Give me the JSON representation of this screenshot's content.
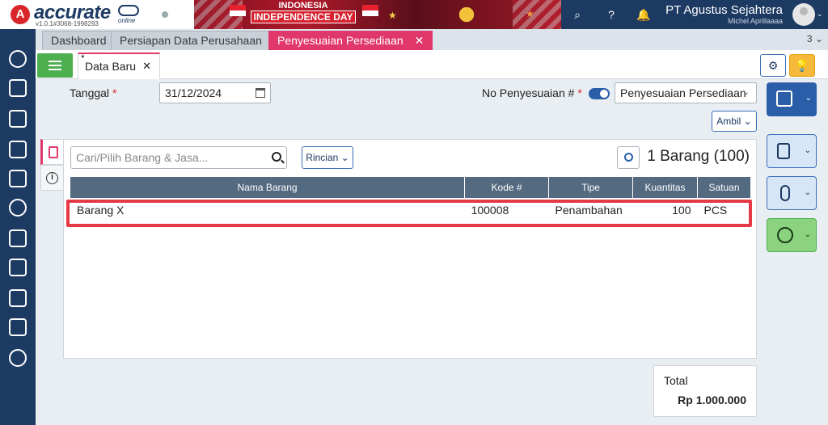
{
  "header": {
    "logo_text": "accurate",
    "logo_sub": "online",
    "version": "v1.0.1#3068-1998293",
    "banner_line1": "INDONESIA",
    "banner_line2": "INDEPENDENCE DAY",
    "company": "PT Agustus Sejahtera",
    "user": "Michel Aprillaaaa"
  },
  "tabs": [
    {
      "label": "Dashboard"
    },
    {
      "label": "Persiapan Data Perusahaan"
    },
    {
      "label": "Penyesuaian Persediaan",
      "active": true
    }
  ],
  "tab_count": "3",
  "subtab": {
    "label": "Data Baru",
    "modified_mark": "*"
  },
  "form": {
    "tanggal_label": "Tanggal",
    "required_mark": "*",
    "tanggal_value": "31/12/2024",
    "no_label": "No Penyesuaian #",
    "type_value": "Penyesuaian Persediaan",
    "ambil_label": "Ambil"
  },
  "panel": {
    "search_placeholder": "Cari/Pilih Barang & Jasa...",
    "rincian_label": "Rincian",
    "count_label": "1 Barang (100)"
  },
  "table": {
    "columns": [
      "Nama Barang",
      "Kode #",
      "Tipe",
      "Kuantitas",
      "Satuan"
    ],
    "rows": [
      {
        "nama": "Barang X",
        "kode": "100008",
        "tipe": "Penambahan",
        "qty": "100",
        "satuan": "PCS"
      }
    ]
  },
  "total": {
    "label": "Total",
    "value": "Rp 1.000.000"
  },
  "colors": {
    "accent": "#e0386b",
    "brand": "#1d3a63",
    "primary": "#2a5ea8",
    "success": "#4caf50",
    "highlight": "#e63946"
  },
  "icons": [
    "settings-icon",
    "upload-icon",
    "building-icon",
    "book-icon",
    "bank-icon",
    "money-bag-icon",
    "cart-icon",
    "cart-box-icon",
    "factory-icon",
    "tax-icon",
    "report-icon"
  ]
}
